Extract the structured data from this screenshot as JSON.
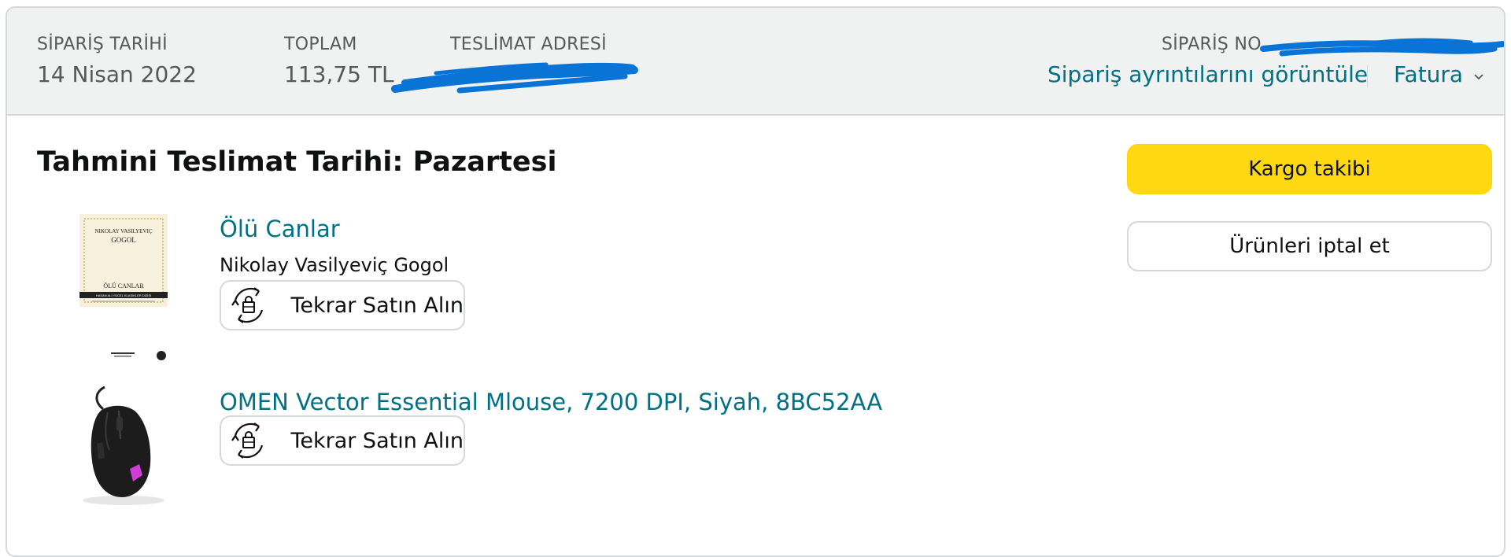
{
  "header": {
    "order_date_label": "SİPARİŞ TARİHİ",
    "order_date_value": "14 Nisan 2022",
    "total_label": "TOPLAM",
    "total_value": "113,75 TL",
    "address_label": "TESLİMAT ADRESİ",
    "order_no_label": "SİPARİŞ NO",
    "view_details_link": "Sipariş ayrıntılarını görüntüle",
    "invoice_link": "Fatura"
  },
  "delivery": {
    "title": "Tahmini Teslimat Tarihi: Pazartesi"
  },
  "actions": {
    "track_label": "Kargo takibi",
    "cancel_label": "Ürünleri iptal et"
  },
  "items": [
    {
      "title": "Ölü Canlar",
      "author": "Nikolay Vasilyeviç Gogol",
      "buy_again_label": "Tekrar Satın Alın",
      "cover": {
        "author_line": "NIKOLAY VASILYEVIÇ",
        "author_surname": "GOGOL",
        "book_title": "ÖLÜ CANLAR",
        "series": "HASAN ALİ YÜCEL KLASİKLER DİZİSİ"
      }
    },
    {
      "title": "OMEN Vector Essential Mlouse, 7200 DPI, Siyah, 8BC52AA",
      "buy_again_label": "Tekrar Satın Alın"
    }
  ],
  "colors": {
    "link": "#007185",
    "primary_button": "#ffd814",
    "header_bg": "#f0f2f2",
    "redaction": "#0a74d6"
  },
  "icons": {
    "invoice_dropdown": "chevron-down-icon",
    "buy_again": "buy-again-bag-icon"
  }
}
